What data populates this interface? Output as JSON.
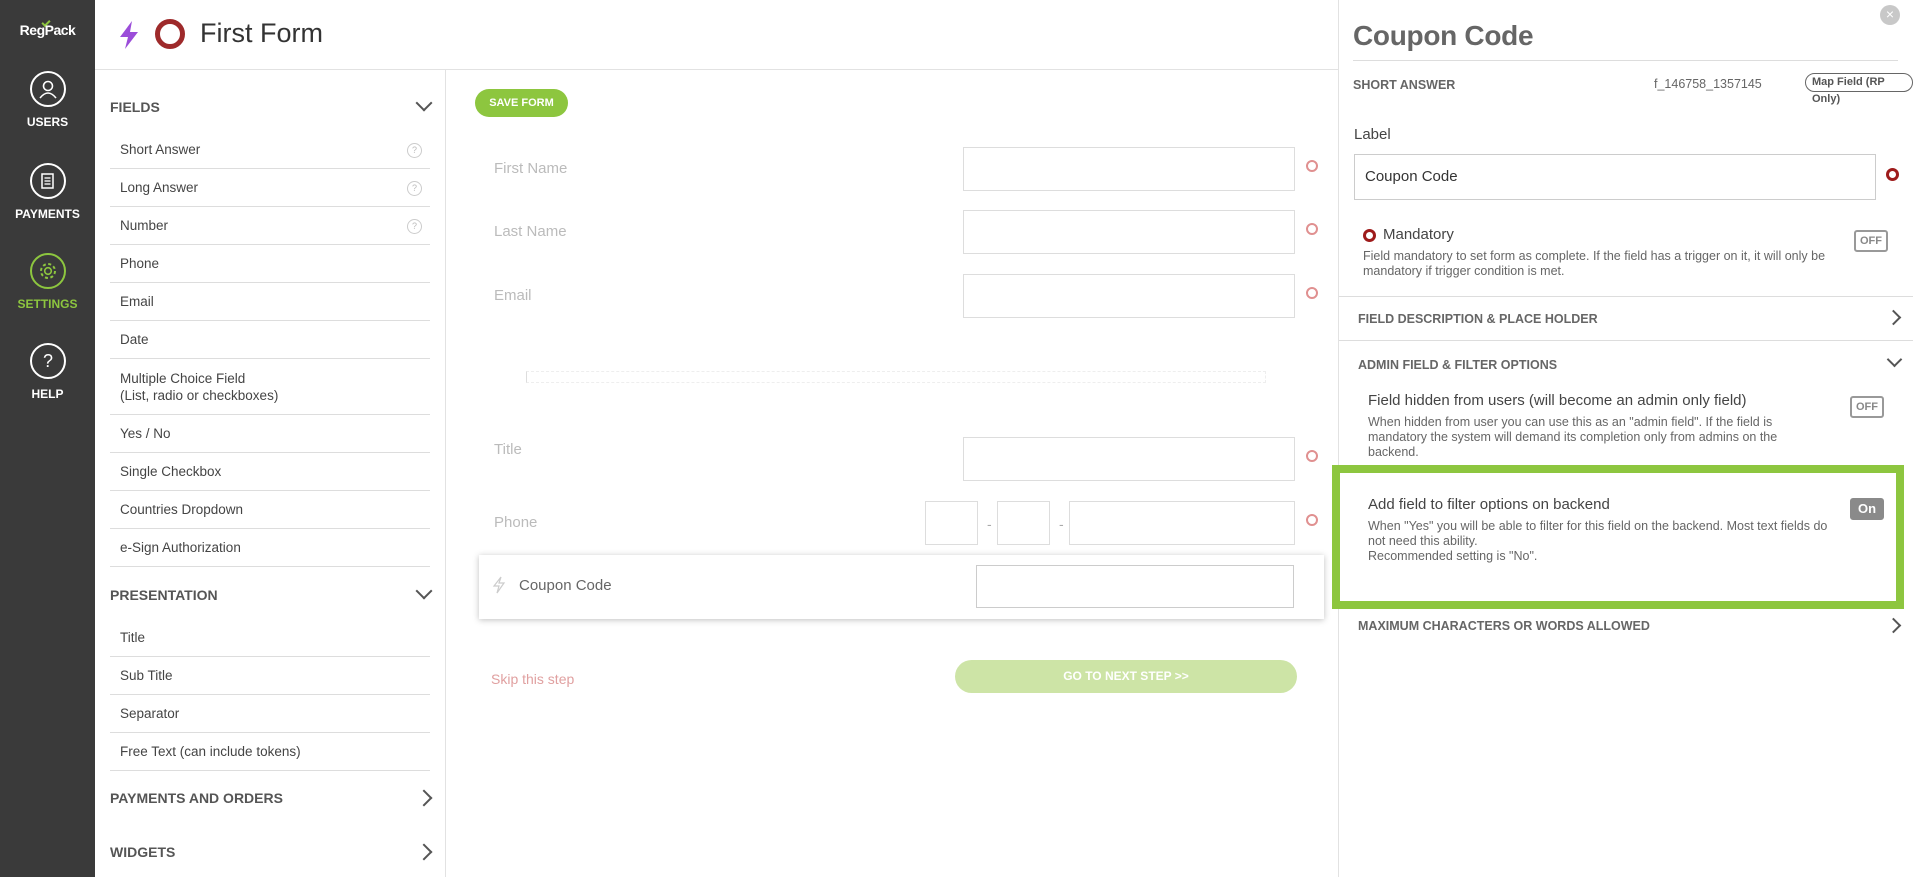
{
  "nav": {
    "logo": "RegPack",
    "items": [
      {
        "label": "USERS"
      },
      {
        "label": "PAYMENTS"
      },
      {
        "label": "SETTINGS"
      },
      {
        "label": "HELP"
      }
    ]
  },
  "header": {
    "title": "First Form"
  },
  "fields_panel": {
    "fields_heading": "FIELDS",
    "fields": [
      "Short Answer",
      "Long Answer",
      "Number",
      "Phone",
      "Email",
      "Date",
      "Multiple Choice Field",
      "(List, radio or checkboxes)",
      "Yes / No",
      "Single Checkbox",
      "Countries Dropdown",
      "e-Sign Authorization"
    ],
    "help_glyph": "?",
    "presentation_heading": "PRESENTATION",
    "presentation": [
      "Title",
      "Sub Title",
      "Separator",
      "Free Text (can include tokens)"
    ],
    "payments_heading": "PAYMENTS AND ORDERS",
    "widgets_heading": "WIDGETS"
  },
  "form": {
    "save_label": "SAVE FORM",
    "first_name": "First Name",
    "last_name": "Last Name",
    "email": "Email",
    "title": "Title",
    "phone": "Phone",
    "phone_dash": "-",
    "coupon": "Coupon Code",
    "skip": "Skip this step",
    "next": "GO TO NEXT STEP >>"
  },
  "right_panel": {
    "close": "×",
    "title": "Coupon Code",
    "type": "SHORT ANSWER",
    "field_id": "f_146758_1357145",
    "map_badge": "Map Field (RP Only)",
    "label_heading": "Label",
    "label_value": "Coupon Code",
    "mandatory_title": "Mandatory",
    "mandatory_desc": "Field mandatory to set form as complete. If the field has a trigger on it, it will only be mandatory if trigger condition is met.",
    "mandatory_toggle": "OFF",
    "desc_section": "FIELD DESCRIPTION & PLACE HOLDER",
    "admin_section": "ADMIN FIELD & FILTER OPTIONS",
    "hidden_title": "Field hidden from users (will become an admin only field)",
    "hidden_desc": "When hidden from user you can use this as an \"admin field\". If the field is mandatory the system will demand its completion only from admins on the backend.",
    "hidden_toggle": "OFF",
    "filter_title": "Add field to filter options on backend",
    "filter_desc1": "When \"Yes\" you will be able to filter for this field on the backend. Most text fields do not need this ability.",
    "filter_desc2": "Recommended setting is \"No\".",
    "filter_toggle": "On",
    "max_section": "MAXIMUM CHARACTERS OR WORDS ALLOWED"
  },
  "colors": {
    "accent": "#8dc63f",
    "brand_red": "#9e2a2b",
    "nav_bg": "#3a3a3a"
  }
}
